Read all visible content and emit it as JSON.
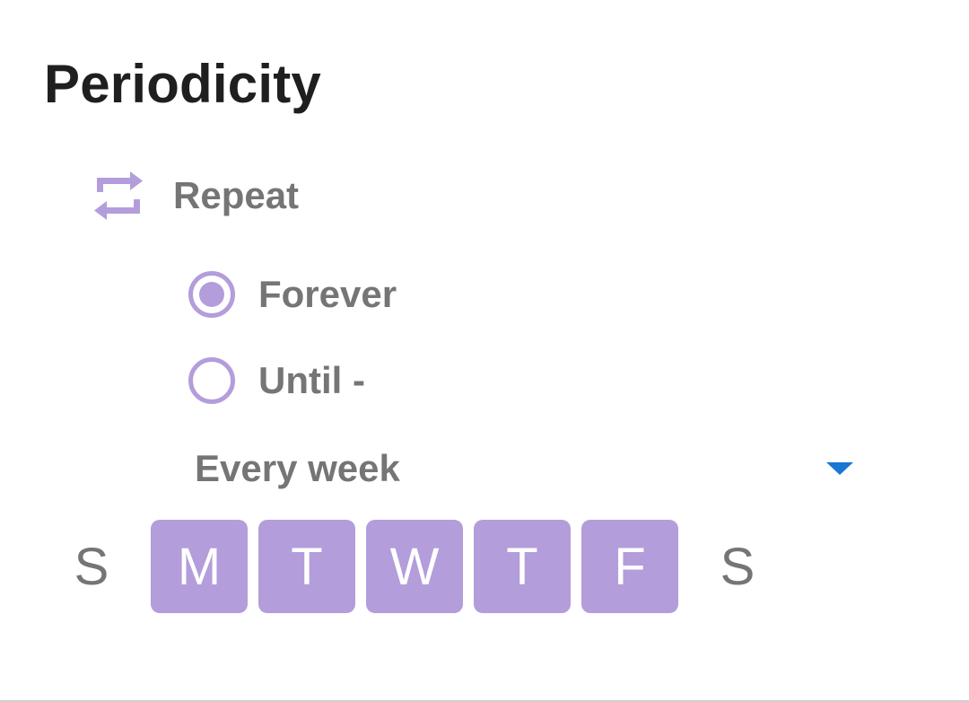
{
  "section": {
    "title": "Periodicity"
  },
  "repeat": {
    "label": "Repeat",
    "icon": "repeat-icon",
    "accent_color": "#b39ddb"
  },
  "options": {
    "forever": {
      "label": "Forever",
      "checked": true
    },
    "until": {
      "label": "Until -",
      "checked": false
    }
  },
  "frequency": {
    "selected": "Every week",
    "arrow_color": "#1976d2"
  },
  "days": [
    {
      "label": "S",
      "selected": false
    },
    {
      "label": "M",
      "selected": true
    },
    {
      "label": "T",
      "selected": true
    },
    {
      "label": "W",
      "selected": true
    },
    {
      "label": "T",
      "selected": true
    },
    {
      "label": "F",
      "selected": true
    },
    {
      "label": "S",
      "selected": false
    }
  ]
}
